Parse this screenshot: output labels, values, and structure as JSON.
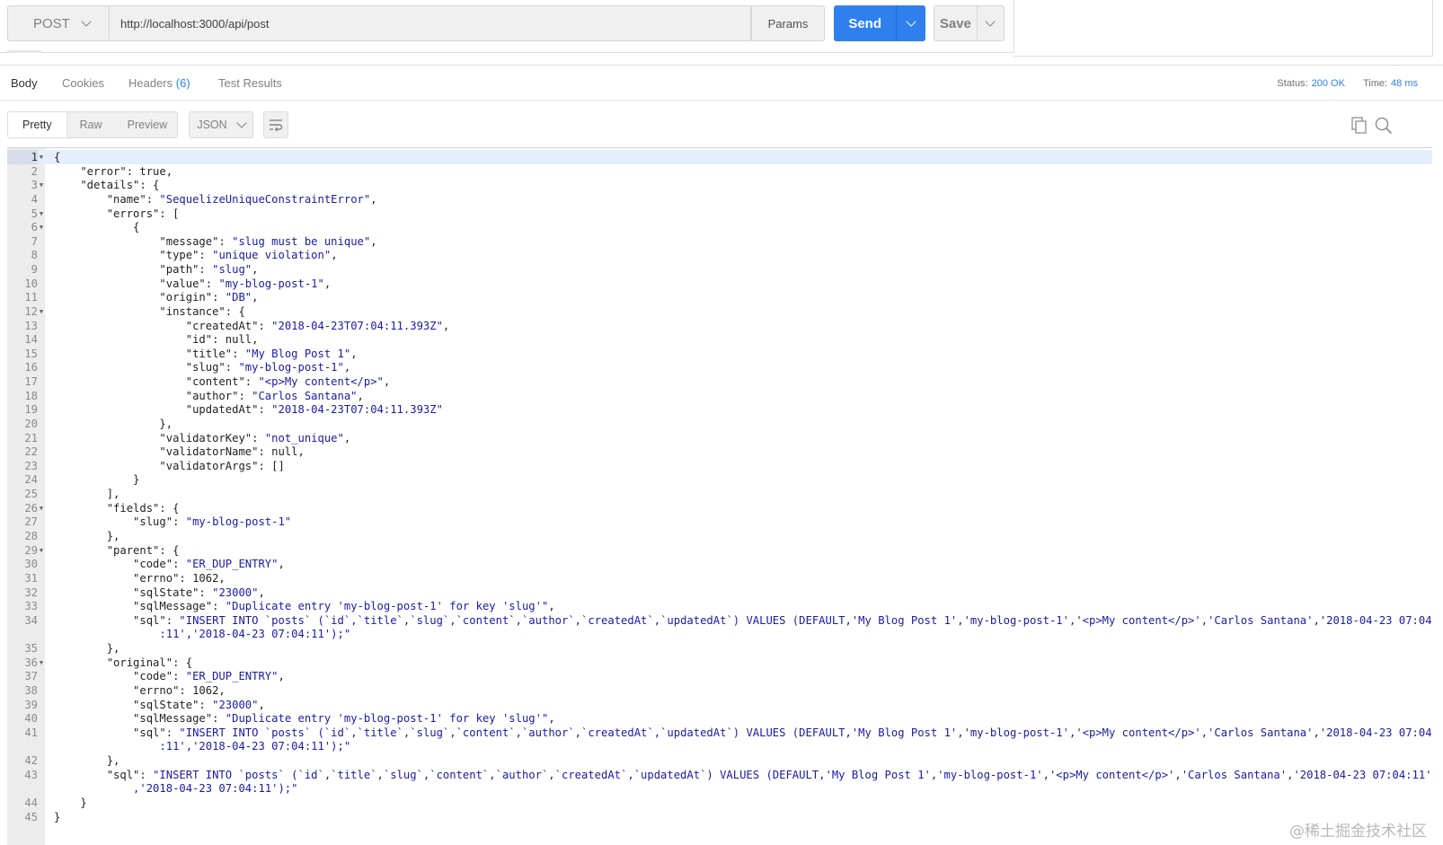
{
  "request": {
    "method": "POST",
    "url": "http://localhost:3000/api/post",
    "params_label": "Params",
    "send_label": "Send",
    "save_label": "Save"
  },
  "response_tabs": [
    {
      "label": "Body",
      "count": ""
    },
    {
      "label": "Cookies",
      "count": ""
    },
    {
      "label": "Headers",
      "count": "(6)"
    },
    {
      "label": "Test Results",
      "count": ""
    }
  ],
  "status": {
    "label": "Status:",
    "value": "200 OK",
    "time_label": "Time:",
    "time_value": "48 ms"
  },
  "view_modes": [
    "Pretty",
    "Raw",
    "Preview"
  ],
  "language": "JSON",
  "icons": {
    "wrap": "wrap-lines-icon",
    "copy": "copy-icon",
    "search": "search-icon"
  },
  "colors": {
    "accent": "#2f80ed",
    "string": "#1a1aa6"
  },
  "code_lines": [
    {
      "n": "1",
      "fold": true,
      "segs": [
        [
          "p",
          "{"
        ]
      ]
    },
    {
      "n": "2",
      "fold": false,
      "segs": [
        [
          "p",
          "    \"error\": true,"
        ]
      ]
    },
    {
      "n": "3",
      "fold": true,
      "segs": [
        [
          "p",
          "    \"details\": {"
        ]
      ]
    },
    {
      "n": "4",
      "fold": false,
      "segs": [
        [
          "p",
          "        \"name\": "
        ],
        [
          "s",
          "\"SequelizeUniqueConstraintError\""
        ],
        [
          "p",
          ","
        ]
      ]
    },
    {
      "n": "5",
      "fold": true,
      "segs": [
        [
          "p",
          "        \"errors\": ["
        ]
      ]
    },
    {
      "n": "6",
      "fold": true,
      "segs": [
        [
          "p",
          "            {"
        ]
      ]
    },
    {
      "n": "7",
      "fold": false,
      "segs": [
        [
          "p",
          "                \"message\": "
        ],
        [
          "s",
          "\"slug must be unique\""
        ],
        [
          "p",
          ","
        ]
      ]
    },
    {
      "n": "8",
      "fold": false,
      "segs": [
        [
          "p",
          "                \"type\": "
        ],
        [
          "s",
          "\"unique violation\""
        ],
        [
          "p",
          ","
        ]
      ]
    },
    {
      "n": "9",
      "fold": false,
      "segs": [
        [
          "p",
          "                \"path\": "
        ],
        [
          "s",
          "\"slug\""
        ],
        [
          "p",
          ","
        ]
      ]
    },
    {
      "n": "10",
      "fold": false,
      "segs": [
        [
          "p",
          "                \"value\": "
        ],
        [
          "s",
          "\"my-blog-post-1\""
        ],
        [
          "p",
          ","
        ]
      ]
    },
    {
      "n": "11",
      "fold": false,
      "segs": [
        [
          "p",
          "                \"origin\": "
        ],
        [
          "s",
          "\"DB\""
        ],
        [
          "p",
          ","
        ]
      ]
    },
    {
      "n": "12",
      "fold": true,
      "segs": [
        [
          "p",
          "                \"instance\": {"
        ]
      ]
    },
    {
      "n": "13",
      "fold": false,
      "segs": [
        [
          "p",
          "                    \"createdAt\": "
        ],
        [
          "s",
          "\"2018-04-23T07:04:11.393Z\""
        ],
        [
          "p",
          ","
        ]
      ]
    },
    {
      "n": "14",
      "fold": false,
      "segs": [
        [
          "p",
          "                    \"id\": null,"
        ]
      ]
    },
    {
      "n": "15",
      "fold": false,
      "segs": [
        [
          "p",
          "                    \"title\": "
        ],
        [
          "s",
          "\"My Blog Post 1\""
        ],
        [
          "p",
          ","
        ]
      ]
    },
    {
      "n": "16",
      "fold": false,
      "segs": [
        [
          "p",
          "                    \"slug\": "
        ],
        [
          "s",
          "\"my-blog-post-1\""
        ],
        [
          "p",
          ","
        ]
      ]
    },
    {
      "n": "17",
      "fold": false,
      "segs": [
        [
          "p",
          "                    \"content\": "
        ],
        [
          "s",
          "\"<p>My content</p>\""
        ],
        [
          "p",
          ","
        ]
      ]
    },
    {
      "n": "18",
      "fold": false,
      "segs": [
        [
          "p",
          "                    \"author\": "
        ],
        [
          "s",
          "\"Carlos Santana\""
        ],
        [
          "p",
          ","
        ]
      ]
    },
    {
      "n": "19",
      "fold": false,
      "segs": [
        [
          "p",
          "                    \"updatedAt\": "
        ],
        [
          "s",
          "\"2018-04-23T07:04:11.393Z\""
        ]
      ]
    },
    {
      "n": "20",
      "fold": false,
      "segs": [
        [
          "p",
          "                },"
        ]
      ]
    },
    {
      "n": "21",
      "fold": false,
      "segs": [
        [
          "p",
          "                \"validatorKey\": "
        ],
        [
          "s",
          "\"not_unique\""
        ],
        [
          "p",
          ","
        ]
      ]
    },
    {
      "n": "22",
      "fold": false,
      "segs": [
        [
          "p",
          "                \"validatorName\": null,"
        ]
      ]
    },
    {
      "n": "23",
      "fold": false,
      "segs": [
        [
          "p",
          "                \"validatorArgs\": []"
        ]
      ]
    },
    {
      "n": "24",
      "fold": false,
      "segs": [
        [
          "p",
          "            }"
        ]
      ]
    },
    {
      "n": "25",
      "fold": false,
      "segs": [
        [
          "p",
          "        ],"
        ]
      ]
    },
    {
      "n": "26",
      "fold": true,
      "segs": [
        [
          "p",
          "        \"fields\": {"
        ]
      ]
    },
    {
      "n": "27",
      "fold": false,
      "segs": [
        [
          "p",
          "            \"slug\": "
        ],
        [
          "s",
          "\"my-blog-post-1\""
        ]
      ]
    },
    {
      "n": "28",
      "fold": false,
      "segs": [
        [
          "p",
          "        },"
        ]
      ]
    },
    {
      "n": "29",
      "fold": true,
      "segs": [
        [
          "p",
          "        \"parent\": {"
        ]
      ]
    },
    {
      "n": "30",
      "fold": false,
      "segs": [
        [
          "p",
          "            \"code\": "
        ],
        [
          "s",
          "\"ER_DUP_ENTRY\""
        ],
        [
          "p",
          ","
        ]
      ]
    },
    {
      "n": "31",
      "fold": false,
      "segs": [
        [
          "p",
          "            \"errno\": 1062,"
        ]
      ]
    },
    {
      "n": "32",
      "fold": false,
      "segs": [
        [
          "p",
          "            \"sqlState\": "
        ],
        [
          "s",
          "\"23000\""
        ],
        [
          "p",
          ","
        ]
      ]
    },
    {
      "n": "33",
      "fold": false,
      "segs": [
        [
          "p",
          "            \"sqlMessage\": "
        ],
        [
          "s",
          "\"Duplicate entry 'my-blog-post-1' for key 'slug'\""
        ],
        [
          "p",
          ","
        ]
      ]
    },
    {
      "n": "34",
      "fold": false,
      "segs": [
        [
          "p",
          "            \"sql\": "
        ],
        [
          "s",
          "\"INSERT INTO `posts` (`id`,`title`,`slug`,`content`,`author`,`createdAt`,`updatedAt`) VALUES (DEFAULT,'My Blog Post 1','my-blog-post-1','<p>My content</p>','Carlos Santana','2018-04-23 07:04"
        ]
      ]
    },
    {
      "n": "",
      "fold": false,
      "segs": [
        [
          "s",
          "                :11','2018-04-23 07:04:11');\""
        ]
      ]
    },
    {
      "n": "35",
      "fold": false,
      "segs": [
        [
          "p",
          "        },"
        ]
      ]
    },
    {
      "n": "36",
      "fold": true,
      "segs": [
        [
          "p",
          "        \"original\": {"
        ]
      ]
    },
    {
      "n": "37",
      "fold": false,
      "segs": [
        [
          "p",
          "            \"code\": "
        ],
        [
          "s",
          "\"ER_DUP_ENTRY\""
        ],
        [
          "p",
          ","
        ]
      ]
    },
    {
      "n": "38",
      "fold": false,
      "segs": [
        [
          "p",
          "            \"errno\": 1062,"
        ]
      ]
    },
    {
      "n": "39",
      "fold": false,
      "segs": [
        [
          "p",
          "            \"sqlState\": "
        ],
        [
          "s",
          "\"23000\""
        ],
        [
          "p",
          ","
        ]
      ]
    },
    {
      "n": "40",
      "fold": false,
      "segs": [
        [
          "p",
          "            \"sqlMessage\": "
        ],
        [
          "s",
          "\"Duplicate entry 'my-blog-post-1' for key 'slug'\""
        ],
        [
          "p",
          ","
        ]
      ]
    },
    {
      "n": "41",
      "fold": false,
      "segs": [
        [
          "p",
          "            \"sql\": "
        ],
        [
          "s",
          "\"INSERT INTO `posts` (`id`,`title`,`slug`,`content`,`author`,`createdAt`,`updatedAt`) VALUES (DEFAULT,'My Blog Post 1','my-blog-post-1','<p>My content</p>','Carlos Santana','2018-04-23 07:04"
        ]
      ]
    },
    {
      "n": "",
      "fold": false,
      "segs": [
        [
          "s",
          "                :11','2018-04-23 07:04:11');\""
        ]
      ]
    },
    {
      "n": "42",
      "fold": false,
      "segs": [
        [
          "p",
          "        },"
        ]
      ]
    },
    {
      "n": "43",
      "fold": false,
      "segs": [
        [
          "p",
          "        \"sql\": "
        ],
        [
          "s",
          "\"INSERT INTO `posts` (`id`,`title`,`slug`,`content`,`author`,`createdAt`,`updatedAt`) VALUES (DEFAULT,'My Blog Post 1','my-blog-post-1','<p>My content</p>','Carlos Santana','2018-04-23 07:04:11'"
        ]
      ]
    },
    {
      "n": "",
      "fold": false,
      "segs": [
        [
          "s",
          "            ,'2018-04-23 07:04:11');\""
        ]
      ]
    },
    {
      "n": "44",
      "fold": false,
      "segs": [
        [
          "p",
          "    }"
        ]
      ]
    },
    {
      "n": "45",
      "fold": false,
      "segs": [
        [
          "p",
          "}"
        ]
      ]
    }
  ],
  "watermark": "@稀土掘金技术社区"
}
